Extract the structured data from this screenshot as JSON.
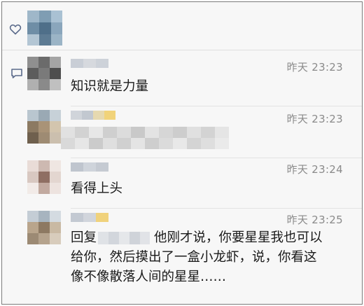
{
  "comments": [
    {
      "time": "昨天 23:23",
      "text": "知识就是力量"
    },
    {
      "time": "昨天 23:23",
      "text": ""
    },
    {
      "time": "昨天 23:24",
      "text": "看得上头"
    },
    {
      "time": "昨天 23:25",
      "reply_prefix": "回复",
      "lines": [
        "他刚才说，你要星星我也可以",
        "给你，然后摸出了一盒小龙虾，说，你看这",
        "像不像散落人间的星星……"
      ]
    }
  ],
  "colors": {
    "background": "#f7f7f7",
    "time_text": "#8a8a8a",
    "body_text": "#1a1a1a",
    "icon_stroke": "#5a6a8a"
  },
  "icons": [
    "heart-icon",
    "comment-icon"
  ]
}
